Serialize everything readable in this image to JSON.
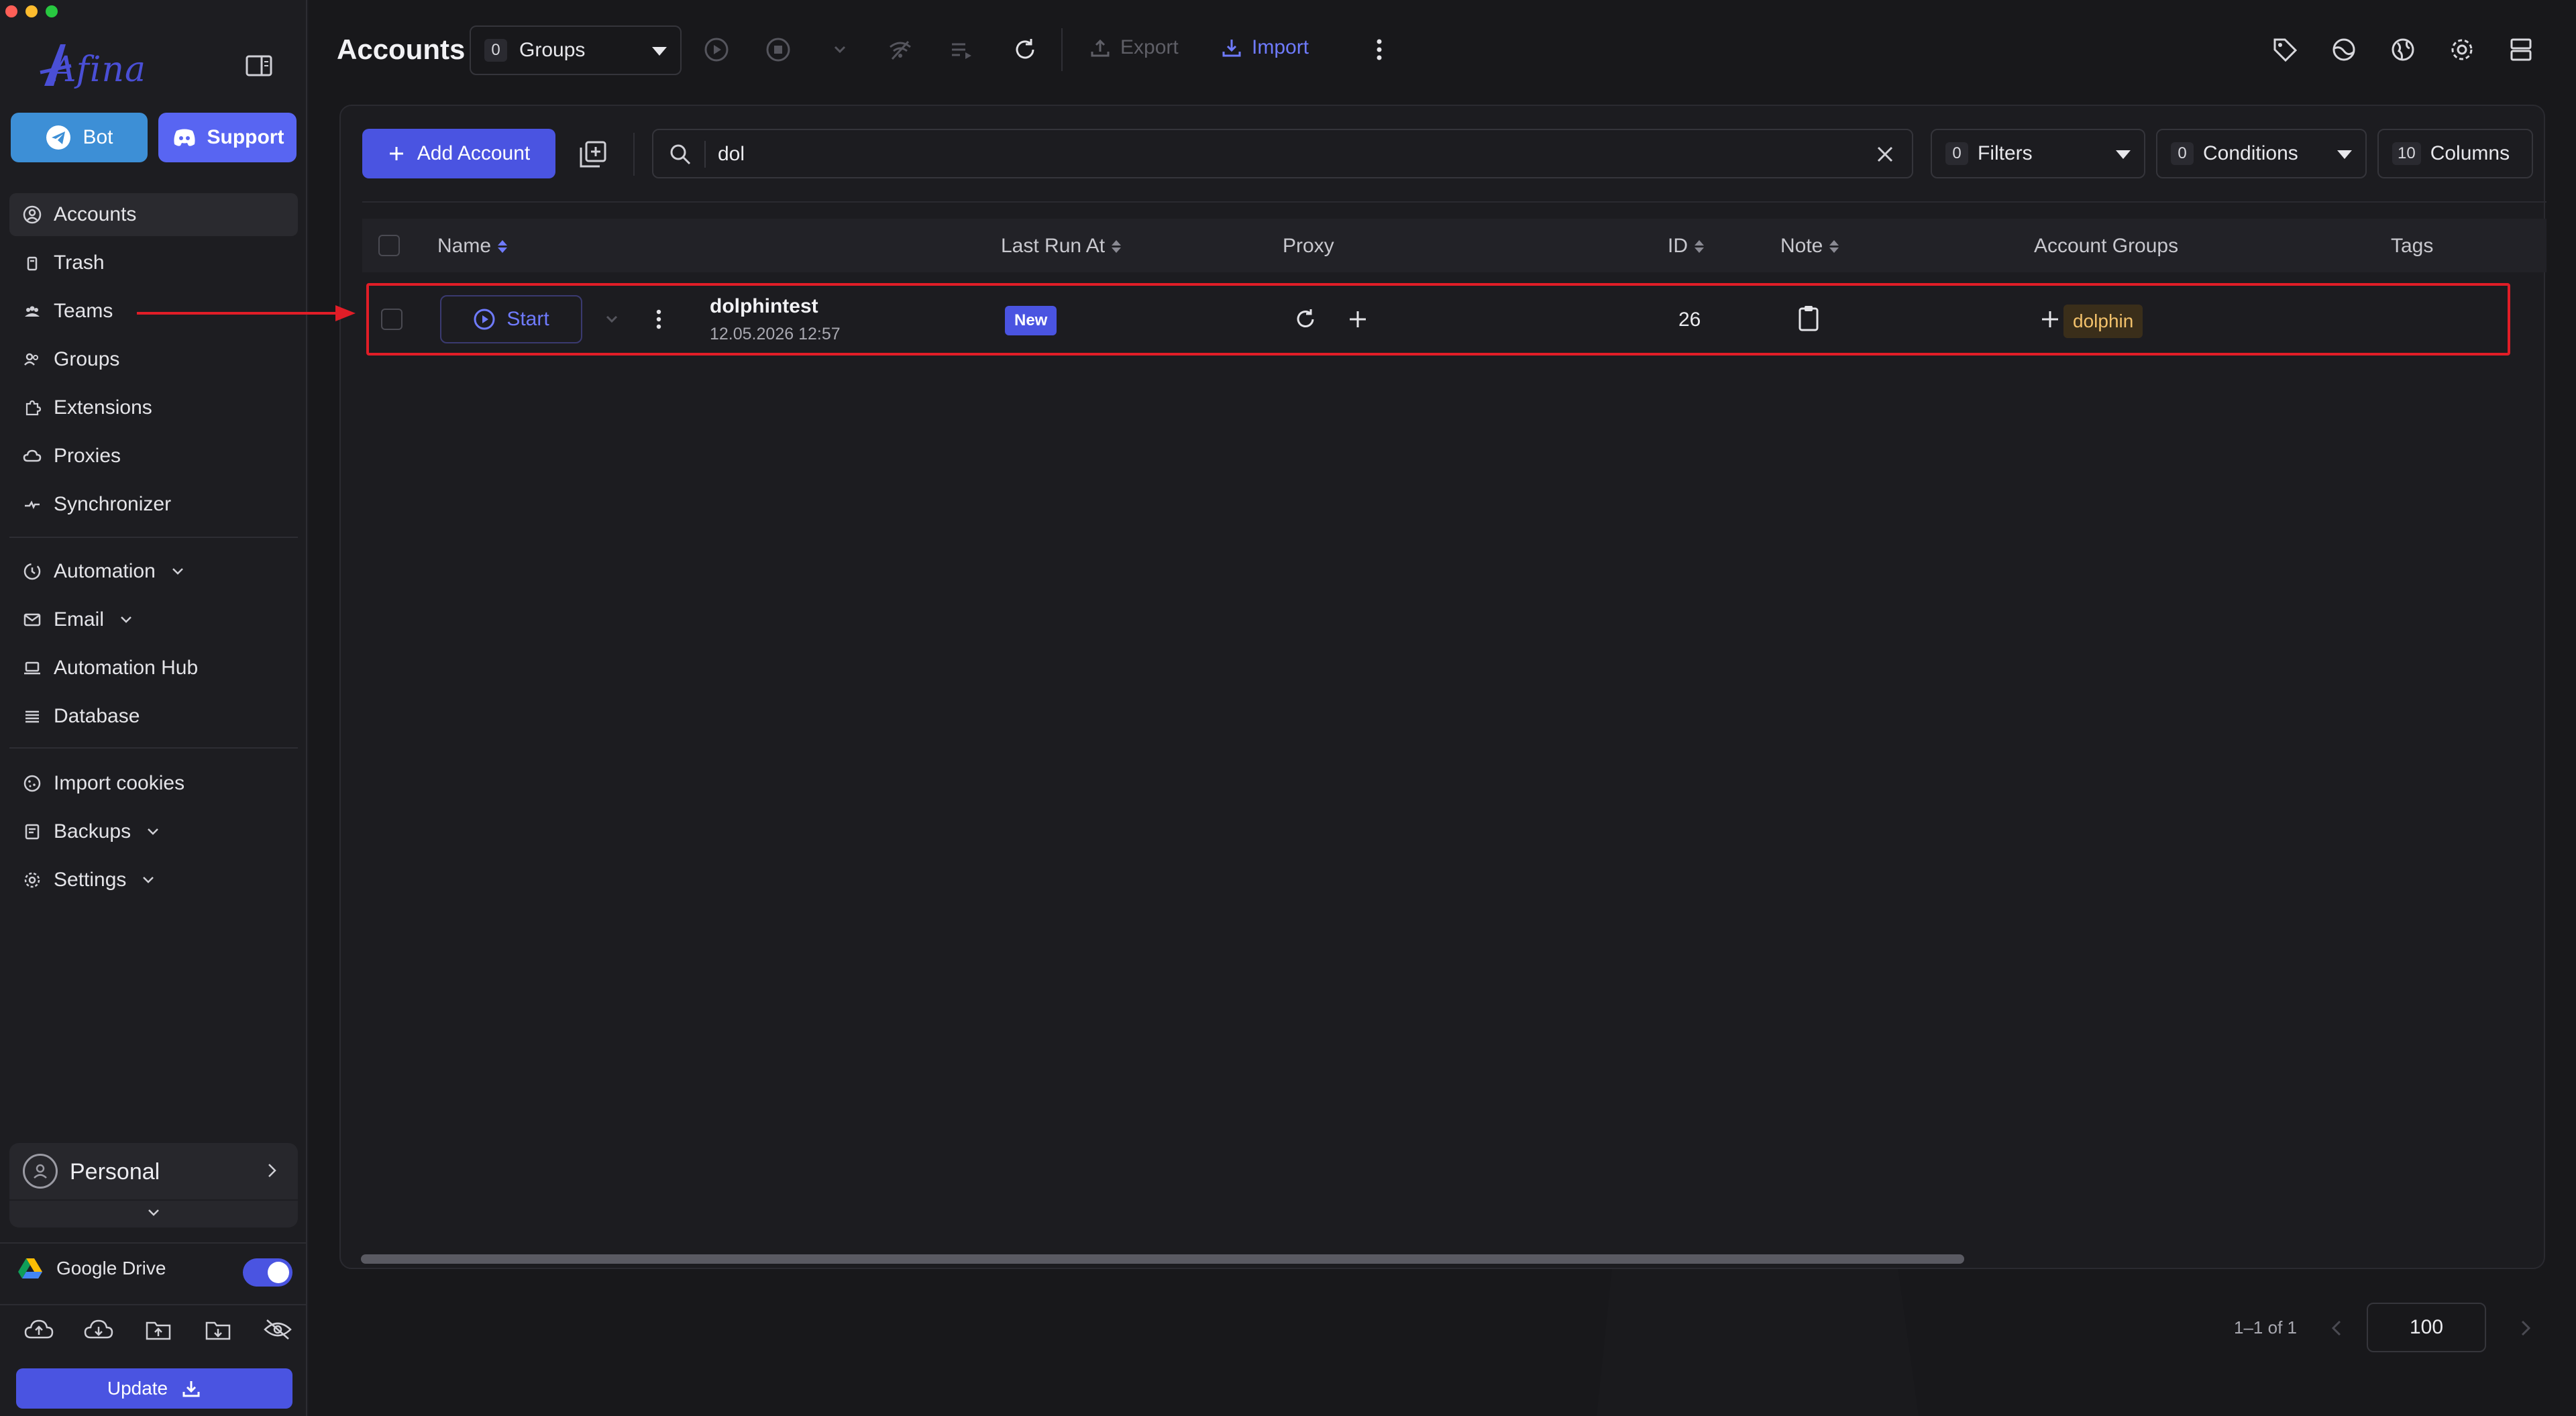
{
  "window": {
    "app_name": "Afina"
  },
  "sidebar": {
    "bot_label": "Bot",
    "support_label": "Support",
    "primary_nav": [
      {
        "label": "Accounts",
        "icon": "user-circle-icon",
        "active": true
      },
      {
        "label": "Trash",
        "icon": "trash-icon"
      },
      {
        "label": "Teams",
        "icon": "users-icon"
      },
      {
        "label": "Groups",
        "icon": "group-icon"
      },
      {
        "label": "Extensions",
        "icon": "puzzle-icon"
      },
      {
        "label": "Proxies",
        "icon": "cloud-icon"
      },
      {
        "label": "Synchronizer",
        "icon": "sync-icon"
      }
    ],
    "secondary_nav": [
      {
        "label": "Automation",
        "icon": "automation-icon",
        "expandable": true
      },
      {
        "label": "Email",
        "icon": "mail-icon",
        "expandable": true
      },
      {
        "label": "Automation Hub",
        "icon": "laptop-icon"
      },
      {
        "label": "Database",
        "icon": "list-icon"
      }
    ],
    "tertiary_nav": [
      {
        "label": "Import cookies",
        "icon": "cookie-icon"
      },
      {
        "label": "Backups",
        "icon": "backup-icon",
        "expandable": true
      },
      {
        "label": "Settings",
        "icon": "gear-icon",
        "expandable": true
      }
    ],
    "workspace_label": "Personal",
    "google_drive_label": "Google Drive",
    "google_drive_enabled": true,
    "update_label": "Update"
  },
  "topbar": {
    "title": "Accounts",
    "groups_count": "0",
    "groups_label": "Groups",
    "export_label": "Export",
    "import_label": "Import"
  },
  "toolbar": {
    "add_account_label": "Add Account",
    "search_value": "dol",
    "filters_count": "0",
    "filters_label": "Filters",
    "conditions_count": "0",
    "conditions_label": "Conditions",
    "columns_count": "10",
    "columns_label": "Columns"
  },
  "table": {
    "columns": {
      "name": "Name",
      "last_run": "Last Run At",
      "proxy": "Proxy",
      "id": "ID",
      "note": "Note",
      "account_groups": "Account Groups",
      "tags": "Tags"
    },
    "rows": [
      {
        "start_label": "Start",
        "name": "dolphintest",
        "created": "12.05.2026 12:57",
        "last_run": "New",
        "id": "26",
        "tag": "dolphin"
      }
    ]
  },
  "pagination": {
    "range": "1–1 of 1",
    "page_size": "100"
  },
  "colors": {
    "accent": "#4a54e1",
    "bot": "#3d8fd6",
    "support": "#5865f2",
    "highlight": "#e11d27",
    "tag_bg": "#3a2e1a",
    "tag_text": "#f2c16b"
  }
}
